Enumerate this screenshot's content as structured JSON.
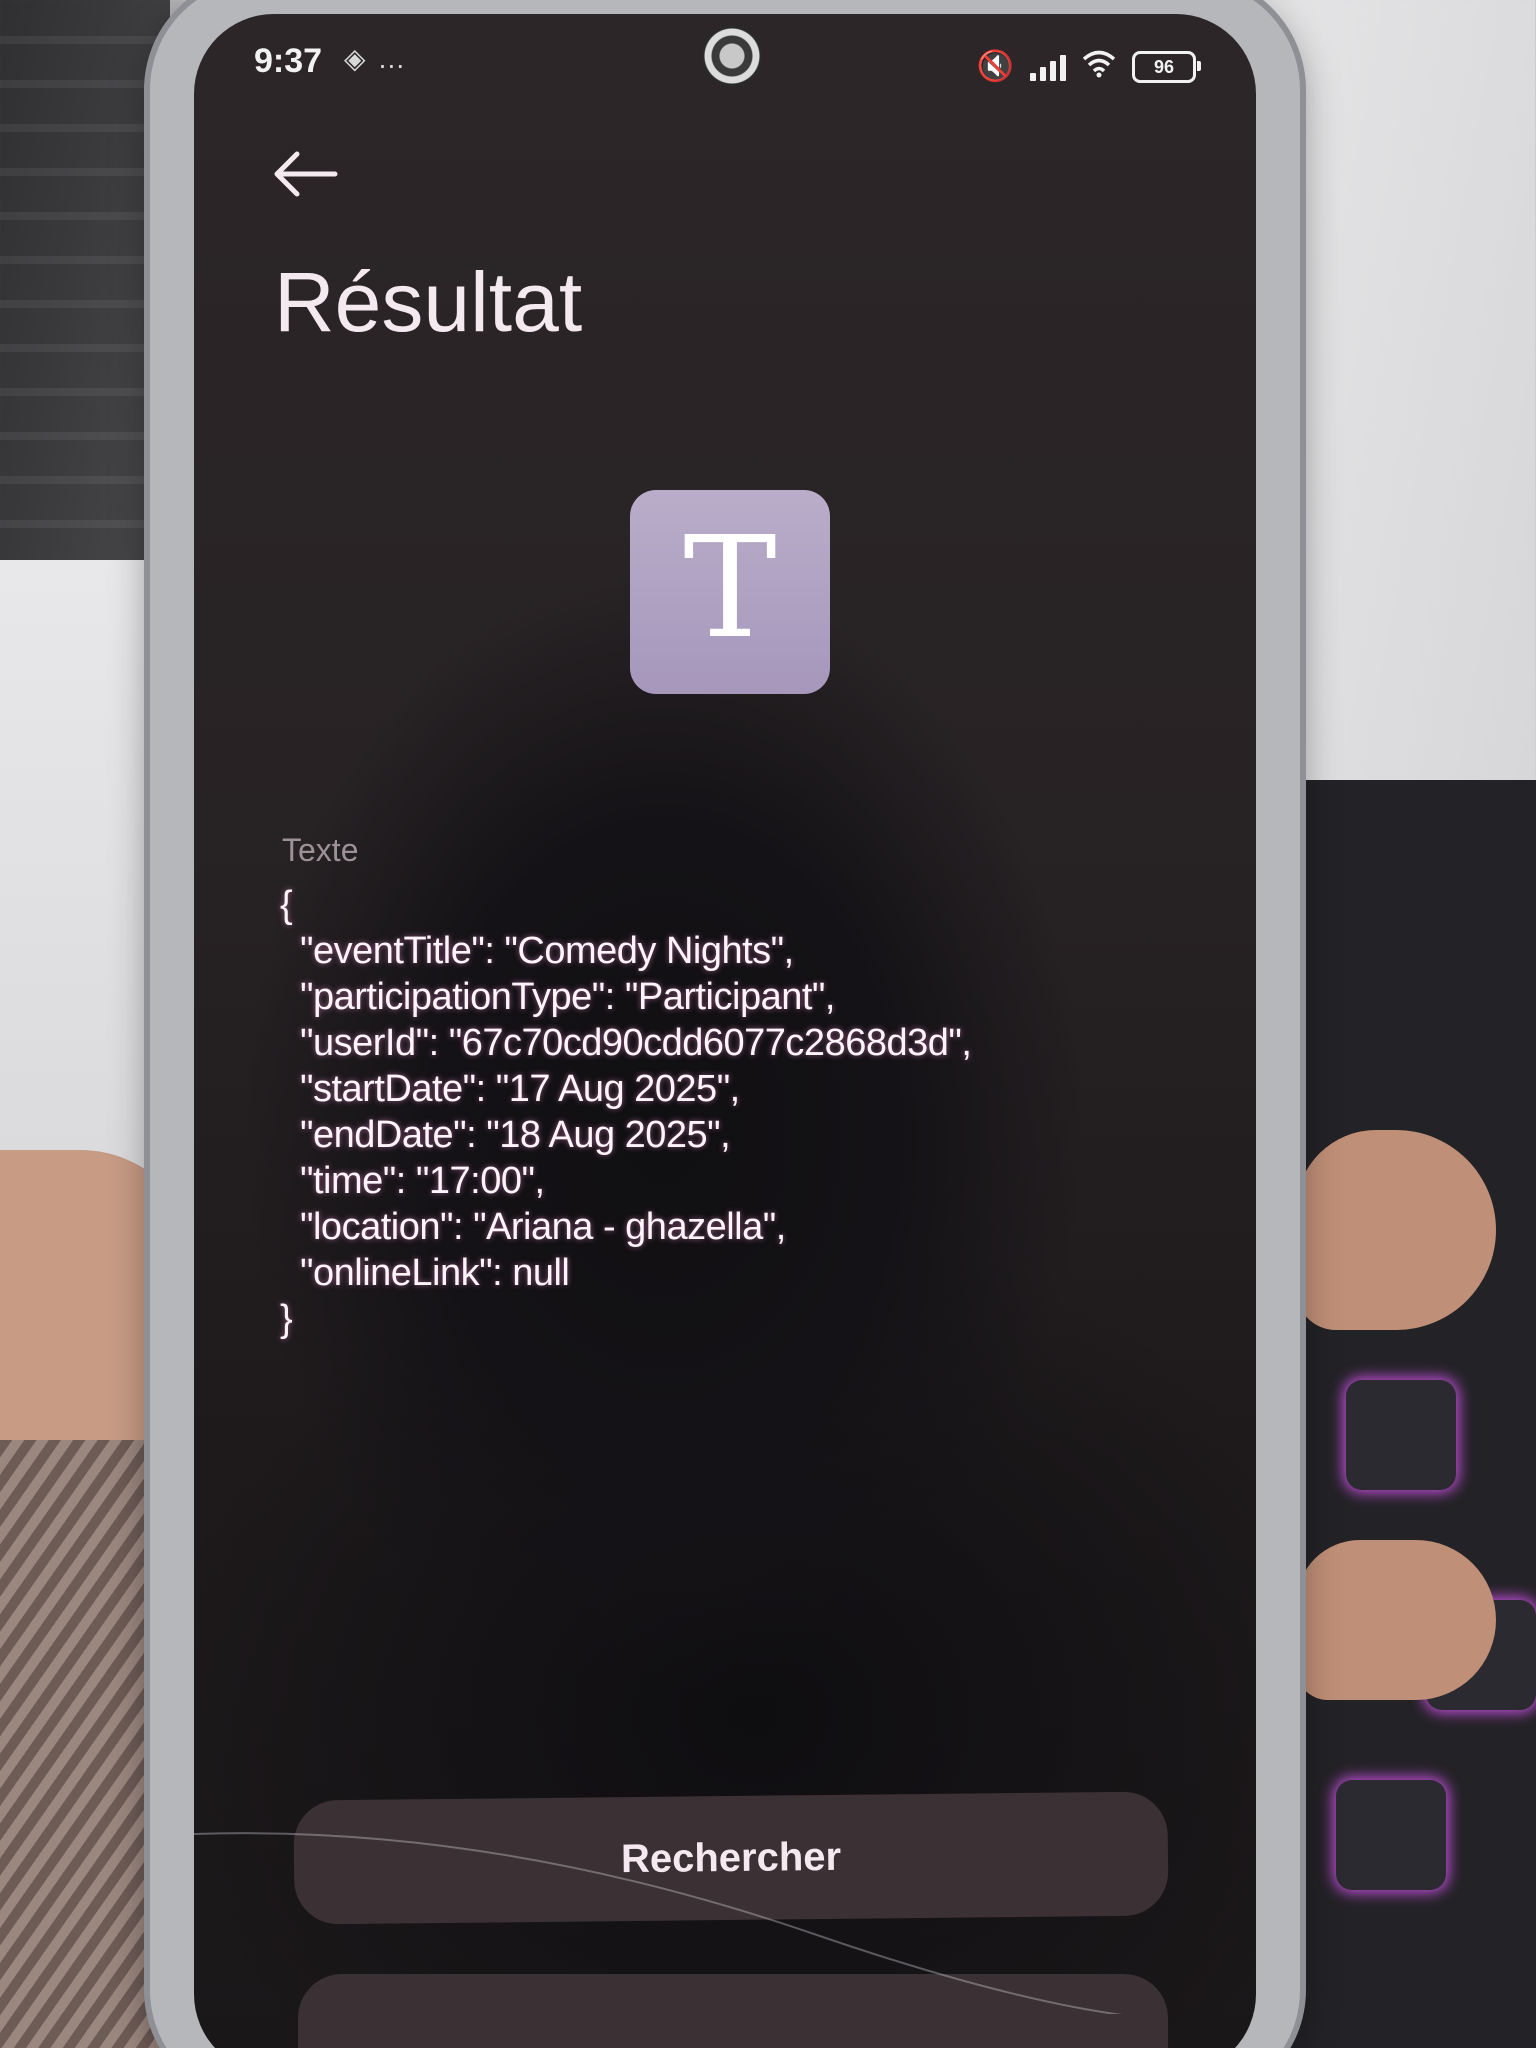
{
  "status_bar": {
    "time": "9:37",
    "left_icons": "…",
    "battery_level": "96"
  },
  "header": {
    "back_icon": "arrow-left-icon",
    "title": "Résultat"
  },
  "result_type": {
    "icon": "text-type-icon",
    "letter": "T"
  },
  "content": {
    "label": "Texte",
    "json_lines": [
      "{",
      "\"eventTitle\": \"Comedy Nights\",",
      "\"participationType\": \"Participant\",",
      "\"userId\": \"67c70cd90cdd6077c2868d3d\",",
      "\"startDate\": \"17 Aug 2025\",",
      "\"endDate\": \"18 Aug 2025\",",
      "\"time\": \"17:00\",",
      "\"location\": \"Ariana - ghazella\",",
      "\"onlineLink\": null",
      "}"
    ]
  },
  "actions": {
    "search_label": "Rechercher"
  },
  "colors": {
    "screen_background": "#272224",
    "title_text": "#f3e9ee",
    "tile_background": "#a697bb",
    "button_background": "#3b3034",
    "json_text": "#fff4fa"
  }
}
